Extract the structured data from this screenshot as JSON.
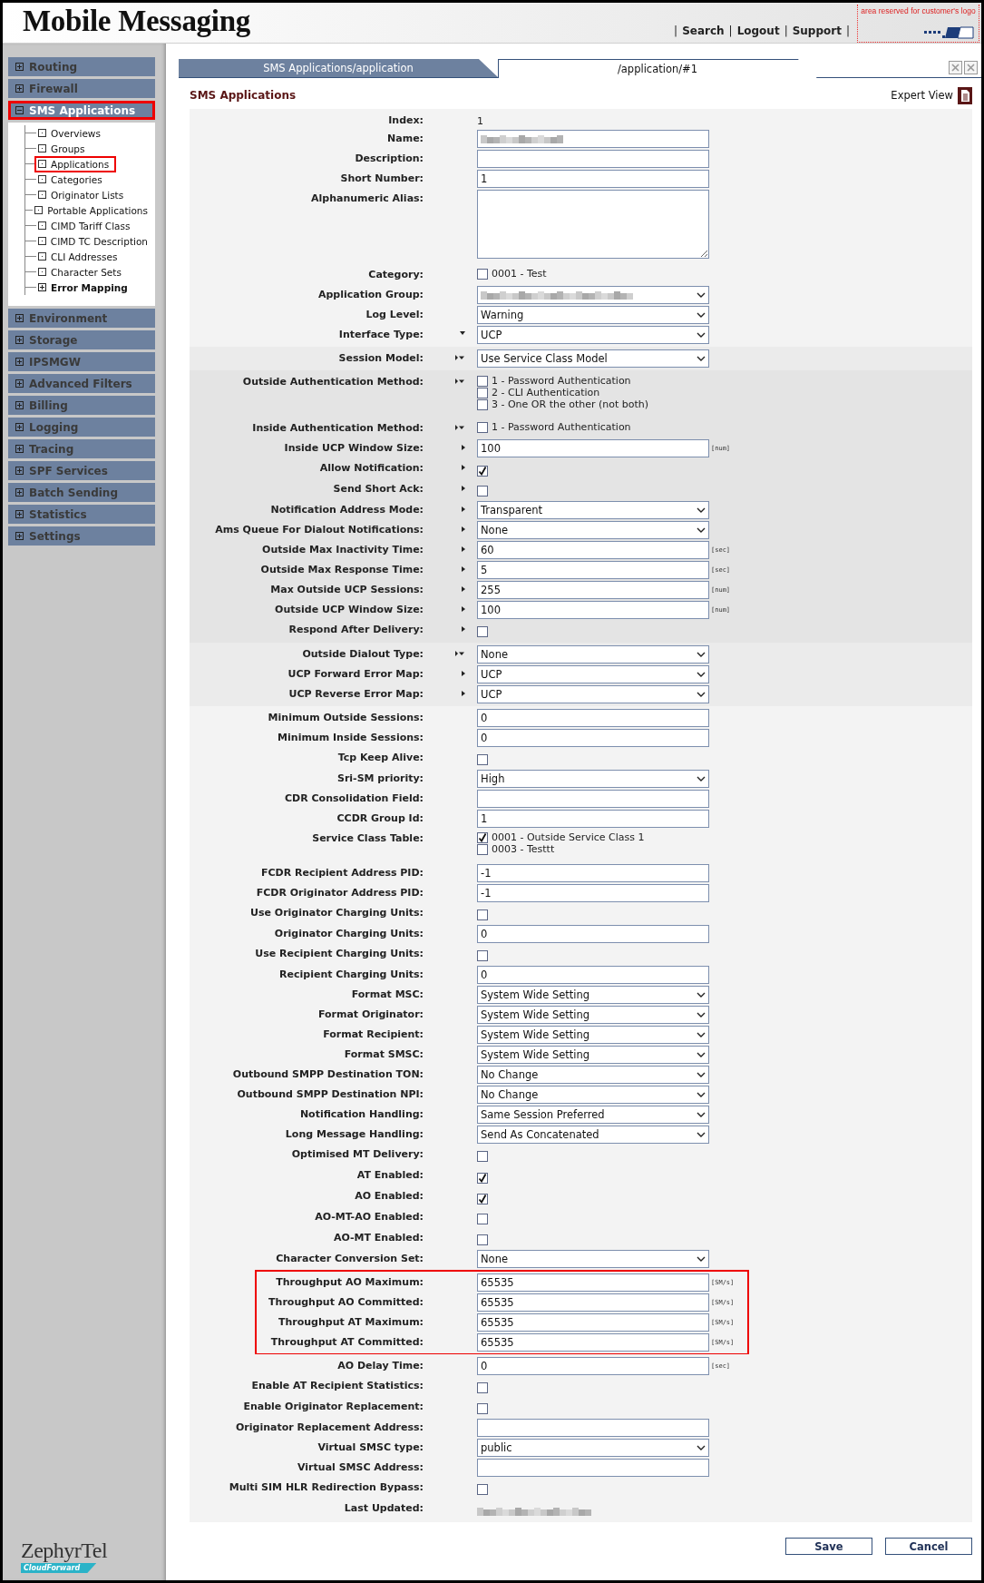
{
  "header": {
    "title": "Mobile Messaging",
    "separator": "|",
    "links": [
      "Search",
      "Logout",
      "Support"
    ],
    "logo_area": "area reserved for customer's logo"
  },
  "sidebar": {
    "items": [
      {
        "label": "Routing",
        "expanded": false,
        "highlighted": false
      },
      {
        "label": "Firewall",
        "expanded": false,
        "highlighted": false
      },
      {
        "label": "SMS Applications",
        "expanded": true,
        "highlighted": true,
        "children": [
          {
            "label": "Overviews",
            "kind": "leaf",
            "highlighted": false
          },
          {
            "label": "Groups",
            "kind": "leaf",
            "highlighted": false
          },
          {
            "label": "Applications",
            "kind": "leaf",
            "highlighted": true
          },
          {
            "label": "Categories",
            "kind": "leaf",
            "highlighted": false
          },
          {
            "label": "Originator Lists",
            "kind": "leaf",
            "highlighted": false
          },
          {
            "label": "Portable Applications",
            "kind": "leaf",
            "highlighted": false
          },
          {
            "label": "CIMD Tariff Class",
            "kind": "leaf",
            "highlighted": false
          },
          {
            "label": "CIMD TC Description",
            "kind": "leaf",
            "highlighted": false
          },
          {
            "label": "CLI Addresses",
            "kind": "leaf",
            "highlighted": false
          },
          {
            "label": "Character Sets",
            "kind": "leaf",
            "highlighted": false
          },
          {
            "label": "Error Mapping",
            "kind": "group",
            "highlighted": false
          }
        ]
      },
      {
        "label": "Environment",
        "expanded": false,
        "highlighted": false
      },
      {
        "label": "Storage",
        "expanded": false,
        "highlighted": false
      },
      {
        "label": "IPSMGW",
        "expanded": false,
        "highlighted": false
      },
      {
        "label": "Advanced Filters",
        "expanded": false,
        "highlighted": false
      },
      {
        "label": "Billing",
        "expanded": false,
        "highlighted": false
      },
      {
        "label": "Logging",
        "expanded": false,
        "highlighted": false
      },
      {
        "label": "Tracing",
        "expanded": false,
        "highlighted": false
      },
      {
        "label": "SPF Services",
        "expanded": false,
        "highlighted": false
      },
      {
        "label": "Batch Sending",
        "expanded": false,
        "highlighted": false
      },
      {
        "label": "Statistics",
        "expanded": false,
        "highlighted": false
      },
      {
        "label": "Settings",
        "expanded": false,
        "highlighted": false
      }
    ],
    "brand": "ZephyrTel",
    "brand_tag": "CloudForward"
  },
  "tabs": [
    {
      "label": "SMS Applications/application",
      "selected": false
    },
    {
      "label": "/application/#1",
      "selected": true
    }
  ],
  "panel": {
    "title": "SMS Applications",
    "expert_view": "Expert View"
  },
  "form": {
    "sections": [
      {
        "kind": "light",
        "highlighted": false,
        "rows": [
          {
            "label": "Index:",
            "kind": "text",
            "value": "1"
          },
          {
            "label": "Name:",
            "kind": "blurred_input"
          },
          {
            "label": "Description:",
            "kind": "input"
          },
          {
            "label": "Short Number:",
            "kind": "input",
            "value": "1"
          },
          {
            "label": "Alphanumeric Alias:",
            "kind": "textarea"
          },
          {
            "label": "Category:",
            "kind": "checklist",
            "options": [
              {
                "label": "0001 - Test",
                "checked": false
              }
            ]
          },
          {
            "label": "Application Group:",
            "kind": "blurred_select"
          },
          {
            "label": "Log Level:",
            "kind": "select",
            "value": "Warning"
          },
          {
            "label": "Interface Type:",
            "kind": "select",
            "value": "UCP",
            "marker": {
              "kind": "down"
            }
          }
        ]
      },
      {
        "kind": "mid",
        "highlighted": false,
        "rows": [
          {
            "label": "Session Model:",
            "kind": "select",
            "value": "Use Service Class Model",
            "marker": {
              "kind": "both"
            }
          }
        ]
      },
      {
        "kind": "dark",
        "highlighted": false,
        "rows": [
          {
            "label": "Outside Authentication Method:",
            "kind": "checklist",
            "marker": {
              "kind": "both"
            },
            "options": [
              {
                "label": "1 - Password Authentication",
                "checked": false
              },
              {
                "label": "2 - CLI Authentication",
                "checked": false
              },
              {
                "label": "3 - One OR the other (not both)",
                "checked": false
              }
            ]
          },
          {
            "label": "Inside Authentication Method:",
            "kind": "checklist",
            "marker": {
              "kind": "both"
            },
            "options": [
              {
                "label": "1 - Password Authentication",
                "checked": false
              }
            ]
          },
          {
            "label": "Inside UCP Window Size:",
            "kind": "input",
            "value": "100",
            "unit": "[num]",
            "marker": {
              "kind": "right"
            }
          },
          {
            "label": "Allow Notification:",
            "kind": "checkbox",
            "checked": true,
            "marker": {
              "kind": "right"
            }
          },
          {
            "label": "Send Short Ack:",
            "kind": "checkbox",
            "checked": false,
            "marker": {
              "kind": "right"
            }
          },
          {
            "label": "Notification Address Mode:",
            "kind": "select",
            "value": "Transparent",
            "marker": {
              "kind": "right"
            }
          },
          {
            "label": "Ams Queue For Dialout Notifications:",
            "kind": "select",
            "value": "None",
            "marker": {
              "kind": "right"
            }
          },
          {
            "label": "Outside Max Inactivity Time:",
            "kind": "input",
            "value": "60",
            "unit": "[sec]",
            "marker": {
              "kind": "right"
            }
          },
          {
            "label": "Outside Max Response Time:",
            "kind": "input",
            "value": "5",
            "unit": "[sec]",
            "marker": {
              "kind": "right"
            }
          },
          {
            "label": "Max Outside UCP Sessions:",
            "kind": "input",
            "value": "255",
            "unit": "[num]",
            "marker": {
              "kind": "right"
            }
          },
          {
            "label": "Outside UCP Window Size:",
            "kind": "input",
            "value": "100",
            "unit": "[num]",
            "marker": {
              "kind": "right"
            }
          },
          {
            "label": "Respond After Delivery:",
            "kind": "checkbox",
            "checked": false,
            "marker": {
              "kind": "right"
            }
          }
        ]
      },
      {
        "kind": "mid",
        "highlighted": false,
        "rows": [
          {
            "label": "Outside Dialout Type:",
            "kind": "select",
            "value": "None",
            "marker": {
              "kind": "both"
            }
          },
          {
            "label": "UCP Forward Error Map:",
            "kind": "select",
            "value": "UCP",
            "marker": {
              "kind": "right"
            }
          },
          {
            "label": "UCP Reverse Error Map:",
            "kind": "select",
            "value": "UCP",
            "marker": {
              "kind": "right"
            }
          }
        ]
      },
      {
        "kind": "light",
        "highlighted": false,
        "rows": [
          {
            "label": "Minimum Outside Sessions:",
            "kind": "input",
            "value": "0"
          },
          {
            "label": "Minimum Inside Sessions:",
            "kind": "input",
            "value": "0"
          },
          {
            "label": "Tcp Keep Alive:",
            "kind": "checkbox",
            "checked": false
          },
          {
            "label": "Sri-SM priority:",
            "kind": "select",
            "value": "High"
          },
          {
            "label": "CDR Consolidation Field:",
            "kind": "input"
          },
          {
            "label": "CCDR Group Id:",
            "kind": "input",
            "value": "1"
          },
          {
            "label": "Service Class Table:",
            "kind": "checklist",
            "options": [
              {
                "label": "0001 - Outside Service Class 1",
                "checked": true
              },
              {
                "label": "0003 - Testtt",
                "checked": false
              }
            ]
          },
          {
            "label": "FCDR Recipient Address PID:",
            "kind": "input",
            "value": "-1"
          },
          {
            "label": "FCDR Originator Address PID:",
            "kind": "input",
            "value": "-1"
          },
          {
            "label": "Use Originator Charging Units:",
            "kind": "checkbox",
            "checked": false
          },
          {
            "label": "Originator Charging Units:",
            "kind": "input",
            "value": "0"
          },
          {
            "label": "Use Recipient Charging Units:",
            "kind": "checkbox",
            "checked": false
          },
          {
            "label": "Recipient Charging Units:",
            "kind": "input",
            "value": "0"
          },
          {
            "label": "Format MSC:",
            "kind": "select",
            "value": "System Wide Setting"
          },
          {
            "label": "Format Originator:",
            "kind": "select",
            "value": "System Wide Setting"
          },
          {
            "label": "Format Recipient:",
            "kind": "select",
            "value": "System Wide Setting"
          },
          {
            "label": "Format SMSC:",
            "kind": "select",
            "value": "System Wide Setting"
          },
          {
            "label": "Outbound SMPP Destination TON:",
            "kind": "select",
            "value": "No Change"
          },
          {
            "label": "Outbound SMPP Destination NPI:",
            "kind": "select",
            "value": "No Change"
          },
          {
            "label": "Notification Handling:",
            "kind": "select",
            "value": "Same Session Preferred"
          },
          {
            "label": "Long Message Handling:",
            "kind": "select",
            "value": "Send As Concatenated"
          },
          {
            "label": "Optimised MT Delivery:",
            "kind": "checkbox",
            "checked": false
          },
          {
            "label": "AT Enabled:",
            "kind": "checkbox",
            "checked": true
          },
          {
            "label": "AO Enabled:",
            "kind": "checkbox",
            "checked": true
          },
          {
            "label": "AO-MT-AO Enabled:",
            "kind": "checkbox",
            "checked": false
          },
          {
            "label": "AO-MT Enabled:",
            "kind": "checkbox",
            "checked": false
          },
          {
            "label": "Character Conversion Set:",
            "kind": "select",
            "value": "None"
          }
        ]
      },
      {
        "kind": "light",
        "highlighted": true,
        "rows": [
          {
            "label": "Throughput AO Maximum:",
            "kind": "input",
            "value": "65535",
            "unit": "[SM/s]"
          },
          {
            "label": "Throughput AO Committed:",
            "kind": "input",
            "value": "65535",
            "unit": "[SM/s]"
          },
          {
            "label": "Throughput AT Maximum:",
            "kind": "input",
            "value": "65535",
            "unit": "[SM/s]"
          },
          {
            "label": "Throughput AT Committed:",
            "kind": "input",
            "value": "65535",
            "unit": "[SM/s]"
          }
        ]
      },
      {
        "kind": "light",
        "highlighted": false,
        "rows": [
          {
            "label": "AO Delay Time:",
            "kind": "input",
            "value": "0",
            "unit": "[sec]"
          },
          {
            "label": "Enable AT Recipient Statistics:",
            "kind": "checkbox",
            "checked": false
          },
          {
            "label": "Enable Originator Replacement:",
            "kind": "checkbox",
            "checked": false
          },
          {
            "label": "Originator Replacement Address:",
            "kind": "input"
          },
          {
            "label": "Virtual SMSC type:",
            "kind": "select",
            "value": "public"
          },
          {
            "label": "Virtual SMSC Address:",
            "kind": "input"
          },
          {
            "label": "Multi SIM HLR Redirection Bypass:",
            "kind": "checkbox",
            "checked": false
          },
          {
            "label": "Last Updated:",
            "kind": "blurred_text"
          }
        ]
      }
    ]
  },
  "buttons": [
    "Save",
    "Cancel"
  ]
}
